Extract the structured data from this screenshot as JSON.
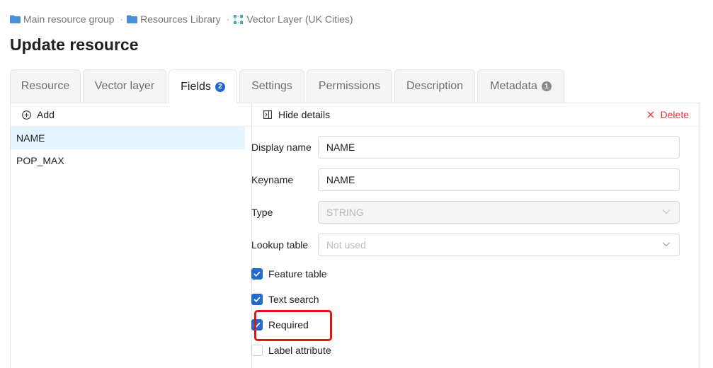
{
  "breadcrumb": {
    "items": [
      {
        "label": "Main resource group",
        "icon": "folder-icon"
      },
      {
        "label": "Resources Library",
        "icon": "folder-icon"
      },
      {
        "label": "Vector Layer (UK Cities)",
        "icon": "vector-layer-icon"
      }
    ],
    "separator": "·"
  },
  "page": {
    "title": "Update resource"
  },
  "tabs": [
    {
      "label": "Resource",
      "active": false
    },
    {
      "label": "Vector layer",
      "active": false
    },
    {
      "label": "Fields",
      "active": true,
      "badge": "2"
    },
    {
      "label": "Settings",
      "active": false
    },
    {
      "label": "Permissions",
      "active": false
    },
    {
      "label": "Description",
      "active": false
    },
    {
      "label": "Metadata",
      "active": false,
      "badge": "1"
    }
  ],
  "left_panel": {
    "add_label": "Add",
    "fields": [
      {
        "name": "NAME",
        "selected": true
      },
      {
        "name": "POP_MAX",
        "selected": false
      }
    ]
  },
  "right_panel": {
    "hide_details_label": "Hide details",
    "delete_label": "Delete",
    "form": {
      "display_name": {
        "label": "Display name",
        "value": "NAME"
      },
      "keyname": {
        "label": "Keyname",
        "value": "NAME"
      },
      "type": {
        "label": "Type",
        "value": "STRING",
        "disabled": true
      },
      "lookup_table": {
        "label": "Lookup table",
        "placeholder": "Not used"
      }
    },
    "checkboxes": [
      {
        "label": "Feature table",
        "checked": true
      },
      {
        "label": "Text search",
        "checked": true
      },
      {
        "label": "Required",
        "checked": true,
        "highlighted": true
      },
      {
        "label": "Label attribute",
        "checked": false
      }
    ]
  },
  "colors": {
    "accent": "#1f6ad1",
    "delete": "#e0353c",
    "highlight": "#e01515",
    "selected_row": "#e6f4ff"
  }
}
